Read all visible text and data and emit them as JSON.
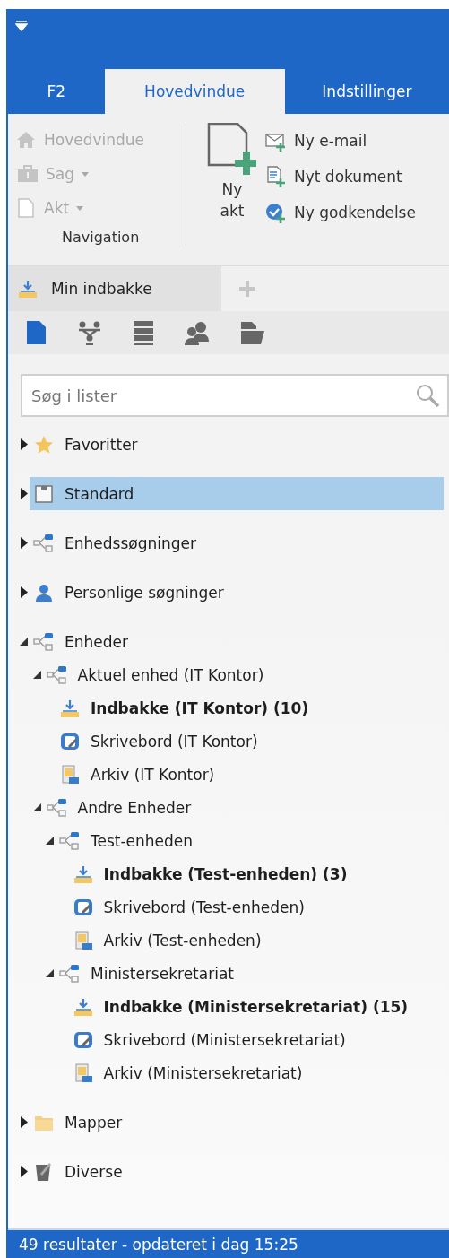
{
  "ribbon_tabs": [
    {
      "label": "F2",
      "selected": false
    },
    {
      "label": "Hovedvindue",
      "selected": true
    },
    {
      "label": "Indstillinger",
      "selected": false
    }
  ],
  "ribbon": {
    "navigation": {
      "label": "Navigation",
      "items": [
        {
          "kind": "home",
          "label": "Hovedvindue",
          "disabled": true,
          "dropdown": false
        },
        {
          "kind": "case",
          "label": "Sag",
          "disabled": true,
          "dropdown": true
        },
        {
          "kind": "page",
          "label": "Akt",
          "disabled": true,
          "dropdown": true
        }
      ]
    },
    "big_button": {
      "lines": [
        "Ny",
        "akt"
      ]
    },
    "actions": [
      {
        "kind": "mail",
        "label": "Ny e-mail"
      },
      {
        "kind": "document",
        "label": "Nyt dokument"
      },
      {
        "kind": "approval",
        "label": "Ny godkendelse"
      }
    ]
  },
  "doc_tabs": [
    {
      "label": "Min indbakke",
      "selected": true
    }
  ],
  "view_buttons": [
    {
      "kind": "document",
      "selected": true
    },
    {
      "kind": "org",
      "selected": false
    },
    {
      "kind": "list",
      "selected": false
    },
    {
      "kind": "users",
      "selected": false
    },
    {
      "kind": "folder",
      "selected": false
    }
  ],
  "search": {
    "placeholder": "Søg i lister"
  },
  "tree": [
    {
      "kind": "star",
      "label": "Favoritter",
      "expanded": false,
      "selected": false
    },
    {
      "kind": "standard",
      "label": "Standard",
      "expanded": false,
      "selected": true
    },
    {
      "kind": "unit",
      "label": "Enhedssøgninger",
      "expanded": false,
      "selected": false
    },
    {
      "kind": "person",
      "label": "Personlige søgninger",
      "expanded": false,
      "selected": false
    },
    {
      "kind": "unit",
      "label": "Enheder",
      "expanded": true,
      "selected": false,
      "children": [
        {
          "kind": "unit",
          "label": "Aktuel enhed (IT Kontor)",
          "expanded": true,
          "selected": false,
          "children": [
            {
              "kind": "inbox",
              "label": "Indbakke (IT Kontor) (10)",
              "selected": false
            },
            {
              "kind": "desk",
              "label": "Skrivebord (IT Kontor)",
              "selected": false
            },
            {
              "kind": "archive",
              "label": "Arkiv (IT Kontor)",
              "selected": false
            }
          ]
        },
        {
          "kind": "unit",
          "label": "Andre Enheder",
          "expanded": true,
          "selected": false,
          "children": [
            {
              "kind": "unit",
              "label": "Test-enheden",
              "expanded": true,
              "selected": false,
              "children": [
                {
                  "kind": "inbox",
                  "label": "Indbakke (Test-enheden) (3)",
                  "selected": false
                },
                {
                  "kind": "desk",
                  "label": "Skrivebord (Test-enheden)",
                  "selected": false
                },
                {
                  "kind": "archive",
                  "label": "Arkiv (Test-enheden)",
                  "selected": false
                }
              ]
            },
            {
              "kind": "unit",
              "label": "Ministersekretariat",
              "expanded": true,
              "selected": false,
              "children": [
                {
                  "kind": "inbox",
                  "label": "Indbakke (Ministersekretariat) (15)",
                  "selected": false
                },
                {
                  "kind": "desk",
                  "label": "Skrivebord (Ministersekretariat)",
                  "selected": false
                },
                {
                  "kind": "archive",
                  "label": "Arkiv (Ministersekretariat)",
                  "selected": false
                }
              ]
            }
          ]
        }
      ]
    },
    {
      "kind": "folder",
      "label": "Mapper",
      "expanded": false,
      "selected": false
    },
    {
      "kind": "misc",
      "label": "Diverse",
      "expanded": false,
      "selected": false
    }
  ],
  "status_bar": {
    "text": "49 resultater - opdateret i dag 15:25"
  }
}
